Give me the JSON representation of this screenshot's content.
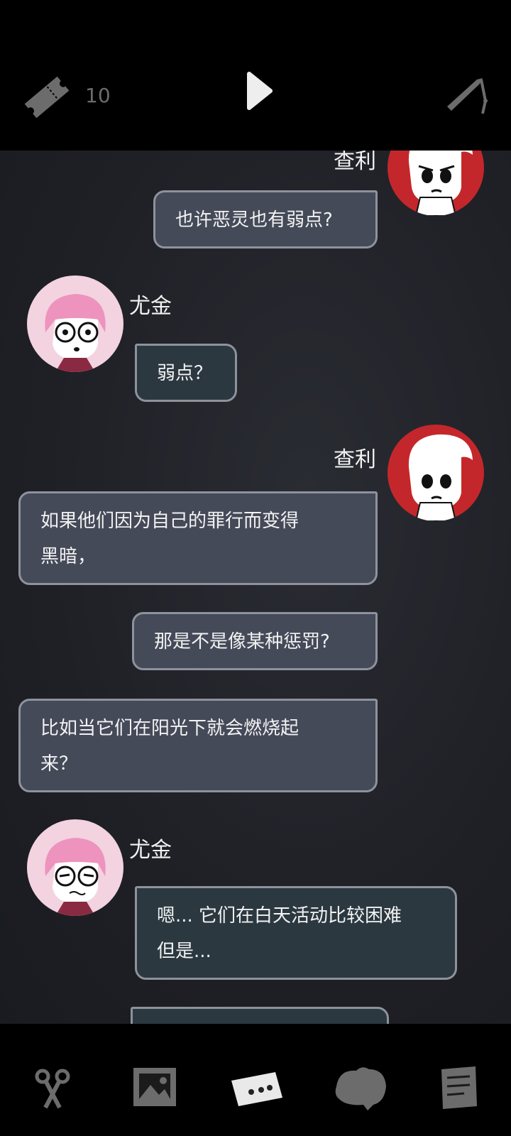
{
  "header": {
    "ticket_icon": "ticket-icon",
    "ticket_count": "10",
    "play_icon": "play-icon",
    "tool_icon": "tweezers-icon"
  },
  "messages": [
    {
      "speaker": "查利",
      "text": "也许恶灵也有弱点?",
      "side": "right"
    },
    {
      "speaker": "尤金",
      "text": "弱点？",
      "side": "left"
    },
    {
      "speaker": "查利",
      "text": "如果他们因为自己的罪行而变得黑暗，",
      "side": "right"
    },
    {
      "speaker": "查利",
      "text": "那是不是像某种惩罚?",
      "side": "right"
    },
    {
      "speaker": "查利",
      "text": "比如当它们在阳光下就会燃烧起来？",
      "side": "right"
    },
    {
      "speaker": "尤金",
      "text": "嗯... 它们在白天活动比较困难但是...",
      "side": "left"
    }
  ],
  "chat": {
    "name_charlie_top": "查利",
    "name_eugene_1": "尤金",
    "name_charlie_2": "查利",
    "name_eugene_2": "尤金",
    "msg1": "也许恶灵也有弱点?",
    "msg2": "弱点？",
    "msg3_line1": "如果他们因为自己的罪行而变得",
    "msg3_line2": "黑暗，",
    "msg4": "那是不是像某种惩罚?",
    "msg5_line1": "比如当它们在阳光下就会燃烧起",
    "msg5_line2": "来？",
    "msg6_line1": "嗯... 它们在白天活动比较困难",
    "msg6_line2": "但是..."
  },
  "bottom_nav": {
    "items": [
      {
        "icon": "scissors-icon"
      },
      {
        "icon": "photo-icon"
      },
      {
        "icon": "chat-icon",
        "active": true
      },
      {
        "icon": "ghost-icon"
      },
      {
        "icon": "notes-icon"
      }
    ]
  },
  "colors": {
    "background": "#1f2026",
    "bubble_right": "#454a59",
    "bubble_left": "#2b3840",
    "bubble_border": "#8d929c",
    "charlie_red": "#c4272b",
    "eugene_pink": "#f2d3df"
  }
}
